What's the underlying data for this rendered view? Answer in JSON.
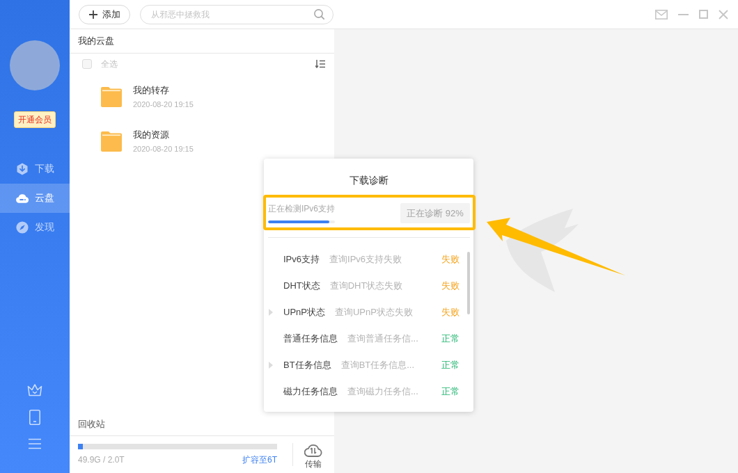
{
  "sidebar": {
    "badge": "开通会员",
    "nav": [
      {
        "label": "下载",
        "selected": false
      },
      {
        "label": "云盘",
        "selected": true
      },
      {
        "label": "发现",
        "selected": false
      }
    ]
  },
  "toolbar": {
    "add_button": "添加",
    "search": {
      "placeholder": "从邪恶中拯救我"
    }
  },
  "panel": {
    "title": "我的云盘",
    "select_all": {
      "label": "全选",
      "checked": false
    },
    "files": [
      {
        "name": "我的转存",
        "date": "2020-08-20 19:15"
      },
      {
        "name": "我的资源",
        "date": "2020-08-20 19:15"
      }
    ],
    "recycle_bin": "回收站",
    "storage": {
      "level": 0.025,
      "usage": "49.9G / 2.0T",
      "upgrade_link": "扩容至6T"
    },
    "transfer_button": "传输"
  },
  "dialog": {
    "title": "下载诊断",
    "progress": {
      "status": "正在检测IPv6支持",
      "level": 0.92,
      "button": "正在诊断 92%",
      "button_disabled": true
    },
    "checks": [
      {
        "name": "IPv6支持",
        "description": "查询IPv6支持失败",
        "result": "失败",
        "kind": "fail",
        "expandable": false
      },
      {
        "name": "DHT状态",
        "description": "查询DHT状态失败",
        "result": "失败",
        "kind": "fail",
        "expandable": false
      },
      {
        "name": "UPnP状态",
        "description": "查询UPnP状态失败",
        "result": "失败",
        "kind": "fail",
        "expandable": true
      },
      {
        "name": "普通任务信息",
        "description": "查询普通任务信...",
        "result": "正常",
        "kind": "ok",
        "expandable": false
      },
      {
        "name": "BT任务信息",
        "description": "查询BT任务信息...",
        "result": "正常",
        "kind": "ok",
        "expandable": true
      },
      {
        "name": "磁力任务信息",
        "description": "查询磁力任务信...",
        "result": "正常",
        "kind": "ok",
        "expandable": false
      }
    ]
  }
}
